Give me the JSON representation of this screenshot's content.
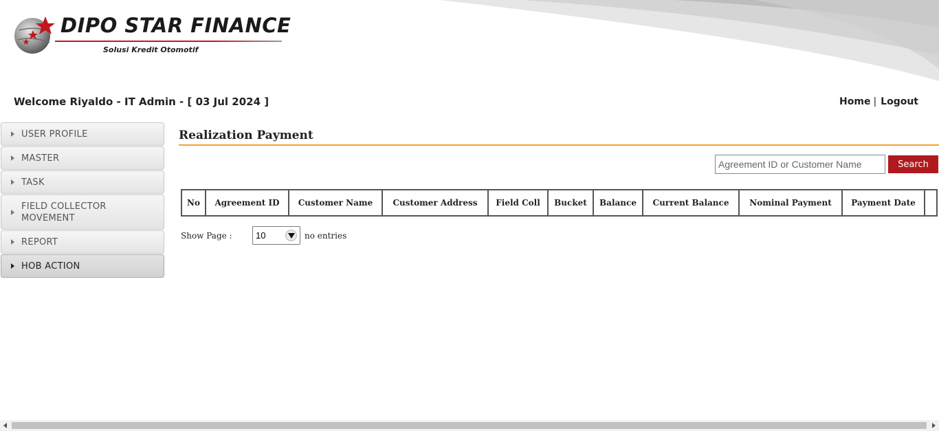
{
  "brand": {
    "name": "DIPO STAR FINANCE",
    "tagline": "Solusi Kredit Otomotif"
  },
  "welcome": {
    "text": "Welcome Riyaldo - IT Admin - [ 03 Jul 2024 ]"
  },
  "top_links": {
    "home": "Home",
    "separator": "|",
    "logout": "Logout"
  },
  "sidebar": {
    "items": [
      {
        "label": "USER PROFILE",
        "icon": "caret-right-icon"
      },
      {
        "label": "MASTER",
        "icon": "caret-right-icon"
      },
      {
        "label": "TASK",
        "icon": "caret-right-icon"
      },
      {
        "label": "FIELD COLLECTOR MOVEMENT",
        "icon": "caret-right-icon"
      },
      {
        "label": "REPORT",
        "icon": "caret-right-icon"
      },
      {
        "label": "HOB ACTION",
        "icon": "caret-right-icon",
        "active": true
      }
    ]
  },
  "main": {
    "title": "Realization Payment",
    "search": {
      "placeholder": "Agreement ID or Customer Name",
      "value": "",
      "button_label": "Search"
    },
    "table": {
      "columns": [
        "No",
        "Agreement ID",
        "Customer Name",
        "Customer Address",
        "Field Coll",
        "Bucket",
        "Balance",
        "Current Balance",
        "Nominal Payment",
        "Payment Date",
        ""
      ]
    },
    "paging": {
      "show_page_label": "Show Page :",
      "page_size": "10",
      "entries_label": "no entries"
    }
  },
  "colors": {
    "accent_rule": "#f2a33a",
    "search_button": "#b01a1e",
    "brand_red": "#c4161c"
  }
}
